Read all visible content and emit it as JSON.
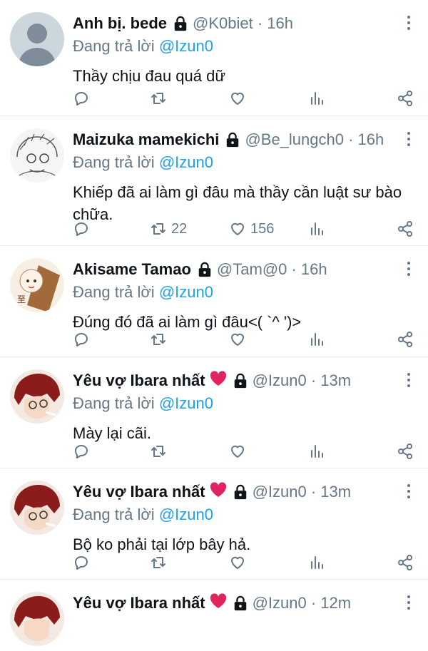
{
  "tweets": [
    {
      "name": "Anh bị. bede",
      "handle": "@K0biet · 16h",
      "reply_prefix": "Đang trả lời",
      "reply_to": "@Izun0",
      "text": "Thầy chịu đau quá dữ",
      "retweets": "",
      "likes": "",
      "avatar": "default-avatar"
    },
    {
      "name": "Maizuka mamekichi",
      "handle": "@Be_lungch0 · 16h",
      "reply_prefix": "Đang trả lời",
      "reply_to": "@Izun0",
      "text": "Khiếp đã ai làm gì đâu mà thầy cần luật sư bào chữa.",
      "retweets": "22",
      "likes": "156",
      "avatar": "sketch-avatar"
    },
    {
      "name": "Akisame Tamao",
      "handle": "@Tam@0 · 16h",
      "reply_prefix": "Đang trả lời",
      "reply_to": "@Izun0",
      "text": "Đúng đó đã ai làm gì đâu<( `^ ')>",
      "retweets": "",
      "likes": "",
      "avatar": "anime-avatar"
    },
    {
      "name": "Yêu vợ Ibara nhất",
      "handle": "@Izun0 · 13m",
      "reply_prefix": "Đang trả lời",
      "reply_to": "@Izun0",
      "text": "Mày lại cãi.",
      "retweets": "",
      "likes": "",
      "avatar": "redhair-avatar"
    },
    {
      "name": "Yêu vợ Ibara nhất",
      "handle": "@Izun0 · 13m",
      "reply_prefix": "Đang trả lời",
      "reply_to": "@Izun0",
      "text": "Bộ ko phải tại lớp bây hả.",
      "retweets": "",
      "likes": "",
      "avatar": "redhair-avatar"
    },
    {
      "name": "Yêu vợ Ibara nhất",
      "handle": "@Izun0 · 12m",
      "avatar": "redhair-avatar"
    }
  ],
  "colors": {
    "accent": "#1da1f2",
    "muted": "#657786",
    "heart_emoji": "#e0245e"
  },
  "icons": [
    "reply-icon",
    "retweet-icon",
    "like-icon",
    "analytics-icon",
    "share-icon",
    "lock-icon",
    "more-icon"
  ]
}
